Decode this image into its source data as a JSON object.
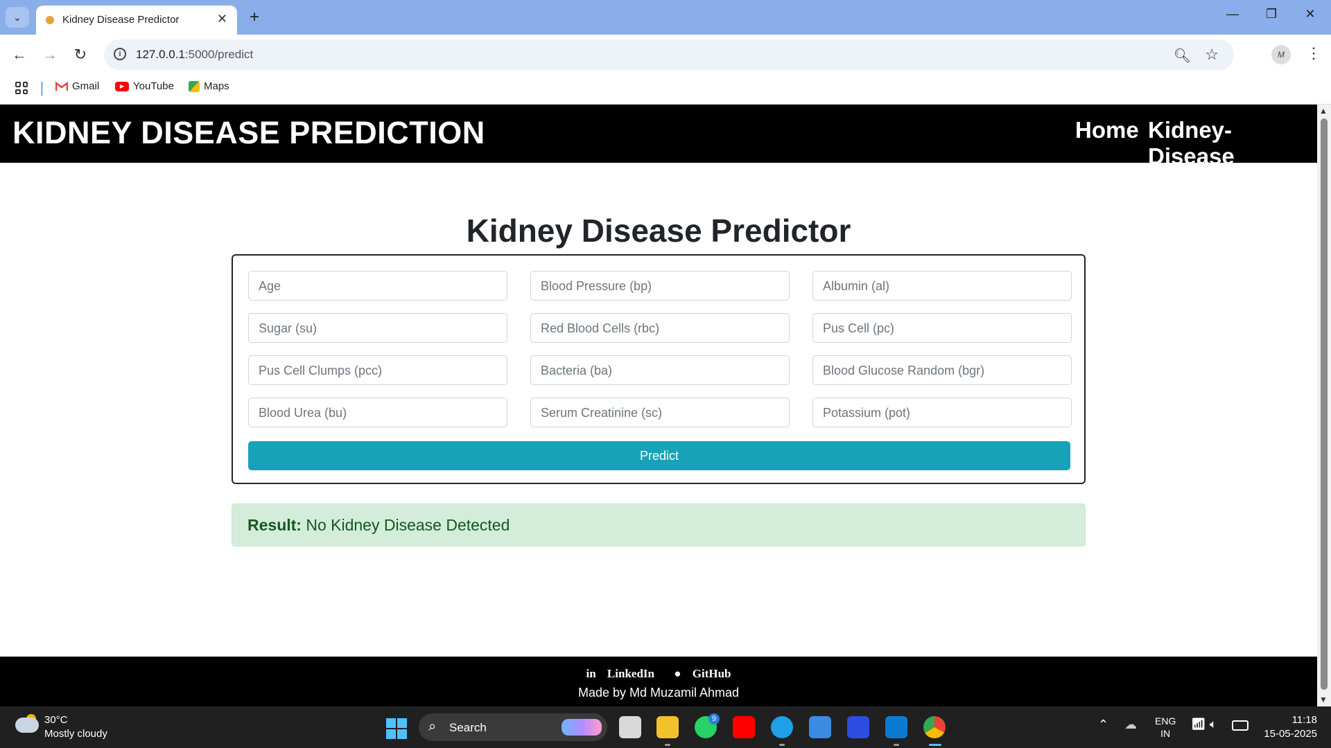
{
  "browser": {
    "tab_title": "Kidney Disease Predictor",
    "url_host": "127.0.0.1",
    "url_path": ":5000/predict",
    "bookmarks": [
      "Gmail",
      "YouTube",
      "Maps"
    ]
  },
  "site": {
    "brand": "KIDNEY DISEASE PREDICTION",
    "nav": [
      "Home",
      "Kidney-Disease"
    ],
    "heading": "Kidney Disease Predictor",
    "fields": [
      {
        "placeholder": "Age"
      },
      {
        "placeholder": "Blood Pressure (bp)"
      },
      {
        "placeholder": "Albumin (al)"
      },
      {
        "placeholder": "Sugar (su)"
      },
      {
        "placeholder": "Red Blood Cells (rbc)"
      },
      {
        "placeholder": "Pus Cell (pc)"
      },
      {
        "placeholder": "Pus Cell Clumps (pcc)"
      },
      {
        "placeholder": "Bacteria (ba)"
      },
      {
        "placeholder": "Blood Glucose Random (bgr)"
      },
      {
        "placeholder": "Blood Urea (bu)"
      },
      {
        "placeholder": "Serum Creatinine (sc)"
      },
      {
        "placeholder": "Potassium (pot)"
      }
    ],
    "predict_label": "Predict",
    "result_label": "Result:",
    "result_text": "No Kidney Disease Detected",
    "footer_links": [
      "LinkedIn",
      "GitHub"
    ],
    "footer_credit": "Made by Md Muzamil Ahmad",
    "colors": {
      "navbar": "#000000",
      "predict_button": "#17a2b8",
      "result_bg": "#d4edda",
      "result_text": "#155724"
    }
  },
  "taskbar": {
    "weather_temp": "30°C",
    "weather_desc": "Mostly cloudy",
    "search_label": "Search",
    "lang_line1": "ENG",
    "lang_line2": "IN",
    "time": "11:18",
    "date": "15-05-2025",
    "whatsapp_badge": "9"
  }
}
